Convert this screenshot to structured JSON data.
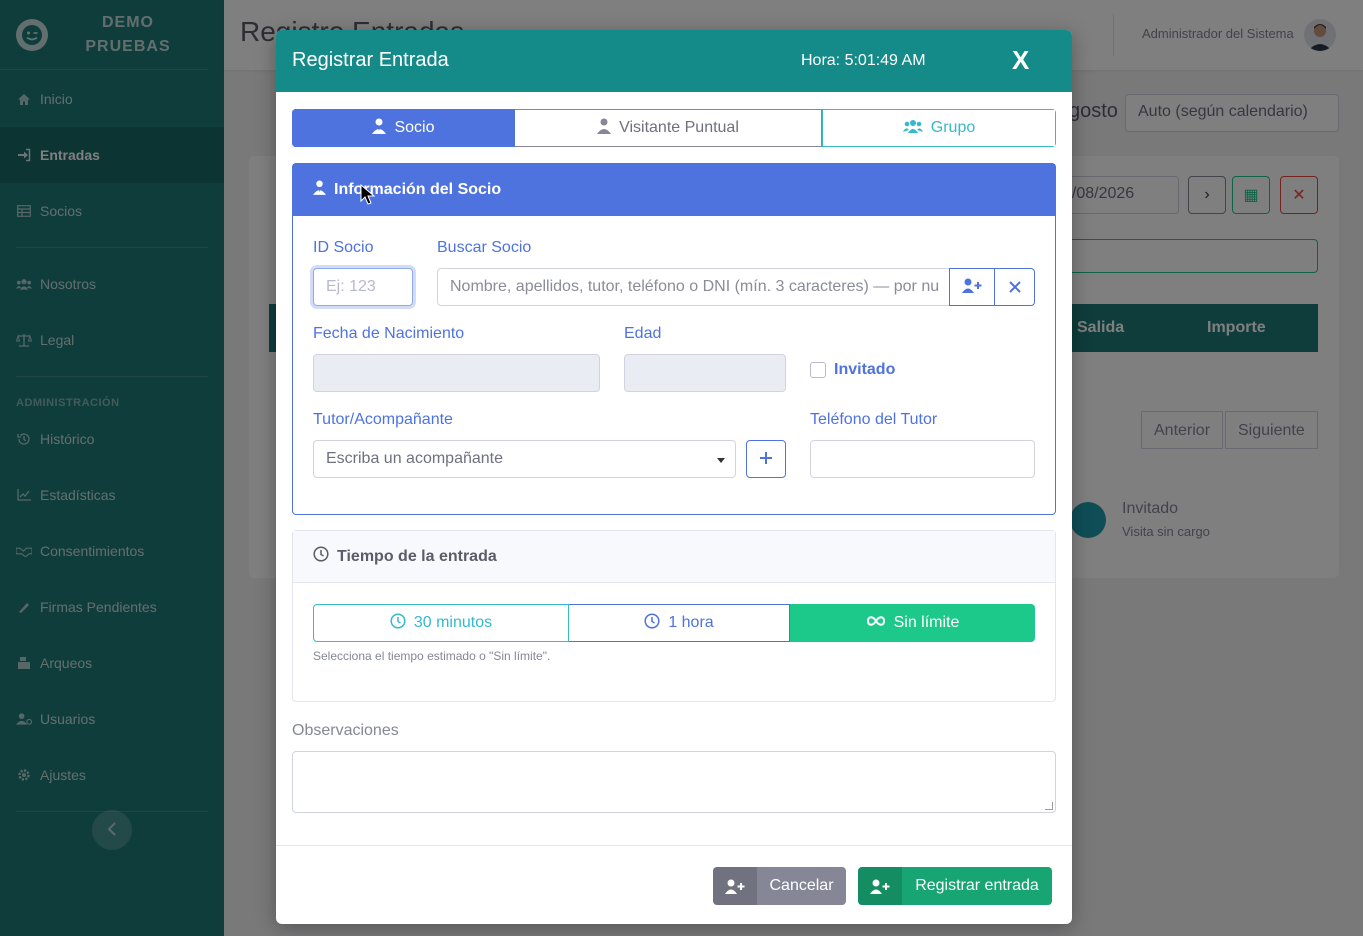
{
  "brand": {
    "line1": "DEMO",
    "line2": "PRUEBAS",
    "logo_icon": "smile-wink-icon"
  },
  "sidebar": {
    "items": [
      {
        "label": "Inicio",
        "icon": "home-icon",
        "active": false
      },
      {
        "label": "Entradas",
        "icon": "sign-in-icon",
        "active": true
      },
      {
        "label": "Socios",
        "icon": "table-icon",
        "active": false
      },
      {
        "label": "Nosotros",
        "icon": "users-icon",
        "active": false
      },
      {
        "label": "Legal",
        "icon": "balance-icon",
        "active": false
      }
    ],
    "admin_heading": "ADMINISTRACIÓN",
    "admin_items": [
      {
        "label": "Histórico",
        "icon": "history-icon"
      },
      {
        "label": "Estadísticas",
        "icon": "chart-line-icon"
      },
      {
        "label": "Consentimientos",
        "icon": "handshake-icon"
      },
      {
        "label": "Firmas Pendientes",
        "icon": "signature-icon"
      },
      {
        "label": "Arqueos",
        "icon": "cash-register-icon"
      },
      {
        "label": "Usuarios",
        "icon": "user-cog-icon"
      },
      {
        "label": "Ajustes",
        "icon": "gear-icon"
      }
    ]
  },
  "page": {
    "title": "Registro Entradas",
    "user_name": "Administrador del Sistema",
    "month_fragment": "gosto",
    "mode_select": "Auto (según calendario)",
    "date_value": "7/08/2026",
    "col_salida": "Salida",
    "col_importe": "Importe",
    "pager_prev": "Anterior",
    "pager_next": "Siguiente",
    "legend_title": "Invitado",
    "legend_sub": "Visita sin cargo"
  },
  "modal": {
    "title": "Registrar Entrada",
    "time": "Hora: 5:01:49 AM",
    "close": "X",
    "tabs": {
      "socio": "Socio",
      "visitante": "Visitante Puntual",
      "grupo": "Grupo"
    },
    "panel_title": "Información del Socio",
    "id_label": "ID Socio",
    "id_placeholder": "Ej: 123",
    "buscar_label": "Buscar Socio",
    "buscar_placeholder": "Nombre, apellidos, tutor, teléfono o DNI (mín. 3 caracteres) — por nu",
    "fecha_label": "Fecha de Nacimiento",
    "edad_label": "Edad",
    "invitado_label": "Invitado",
    "tutor_label": "Tutor/Acompañante",
    "tutor_placeholder": "Escriba un acompañante",
    "telefono_label": "Teléfono del Tutor",
    "time_title": "Tiempo de la entrada",
    "time_opt_30": "30 minutos",
    "time_opt_1h": "1 hora",
    "time_opt_inf": "Sin límite",
    "time_help": "Selecciona el tiempo estimado o \"Sin límite\".",
    "obs_label": "Observaciones",
    "cancel_label": "Cancelar",
    "save_label": "Registrar entrada"
  },
  "colors": {
    "sidebar": "#1f7a78",
    "modal_header": "#158b89",
    "primary": "#4e73df",
    "info": "#36b9cc",
    "success": "#1cc88a",
    "secondary": "#858796"
  }
}
